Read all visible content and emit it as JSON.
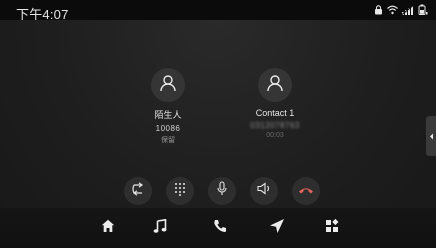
{
  "status_bar": {
    "time": "下午4:07",
    "icons": [
      "lock-icon",
      "wifi-icon",
      "signal-icon",
      "battery-icon"
    ]
  },
  "call": {
    "left_contact": {
      "name": "陌生人",
      "number": "10086",
      "state": "保留",
      "icon": "person-icon"
    },
    "right_contact": {
      "name": "Contact 1",
      "number": "0312078763",
      "duration": "00:03",
      "icon": "person-icon"
    }
  },
  "controls": [
    "swap-icon",
    "keypad-icon",
    "microphone-icon",
    "speaker-icon",
    "hangup-icon"
  ],
  "nav": [
    "home-icon",
    "music-icon",
    "phone-icon",
    "navigation-icon",
    "apps-icon"
  ],
  "colors": {
    "hangup": "#e0645a",
    "background": "#1c1c1c",
    "status_bar": "#0b0b0b"
  }
}
